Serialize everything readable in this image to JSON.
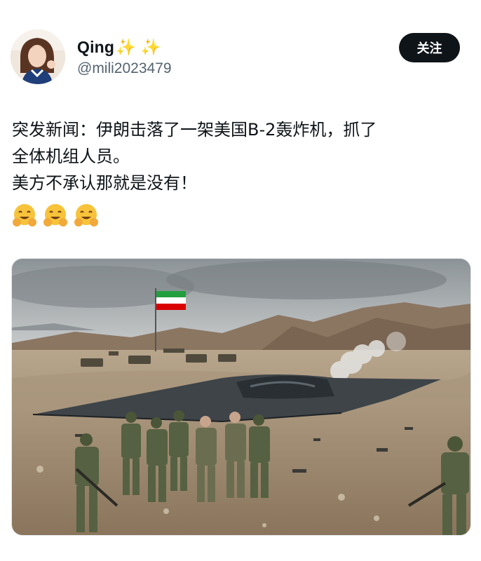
{
  "author": {
    "display_name": "Qing",
    "name_emoji": "✨ ✨",
    "handle": "@mili2023479"
  },
  "follow_button": {
    "label": "关注"
  },
  "post": {
    "lines": [
      "突发新闻：伊朗击落了一架美国B-2轰炸机，抓了",
      "全体机组人员。",
      "美方不承认那就是没有！"
    ],
    "emojis": [
      "hugging-face",
      "hugging-face",
      "hugging-face"
    ]
  },
  "media": {
    "icons": {
      "flag": "iran-flag",
      "aircraft": "stealth-bomber"
    }
  },
  "colors": {
    "text": "#0f1419",
    "secondary": "#536471",
    "button_bg": "#0f1419",
    "button_text": "#ffffff",
    "emoji_yellow": "#f7c33a"
  }
}
